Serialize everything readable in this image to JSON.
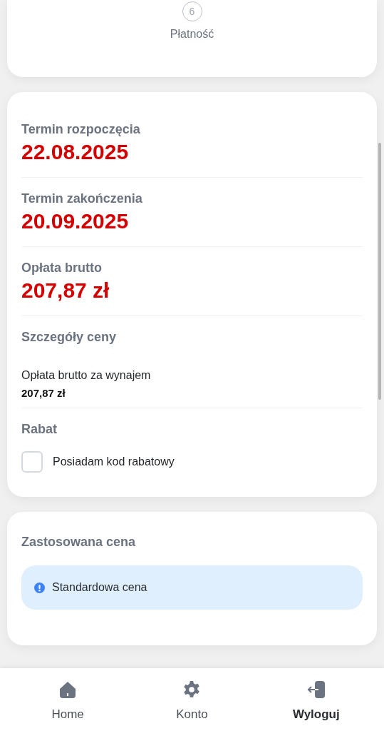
{
  "stepper": {
    "number": "6",
    "label": "Płatność"
  },
  "summary": {
    "fields": [
      {
        "label": "Termin rozpoczęcia",
        "value": "22.08.2025"
      },
      {
        "label": "Termin zakończenia",
        "value": "20.09.2025"
      },
      {
        "label": "Opłata brutto",
        "value": "207,87 zł"
      }
    ],
    "price_details": {
      "title": "Szczegóły ceny",
      "items": [
        {
          "label": "Opłata brutto za wynajem",
          "value": "207,87 zł"
        }
      ]
    },
    "discount": {
      "title": "Rabat",
      "checkbox": {
        "label": "Posiadam kod rabatowy",
        "checked": false
      }
    }
  },
  "applied_price": {
    "title": "Zastosowana cena",
    "notice": "Standardowa cena"
  },
  "bottom_nav": [
    {
      "label": "Home",
      "kind": "home",
      "selected": false
    },
    {
      "label": "Konto",
      "kind": "settings",
      "selected": false
    },
    {
      "label": "Wyloguj",
      "kind": "logout",
      "selected": true
    }
  ]
}
